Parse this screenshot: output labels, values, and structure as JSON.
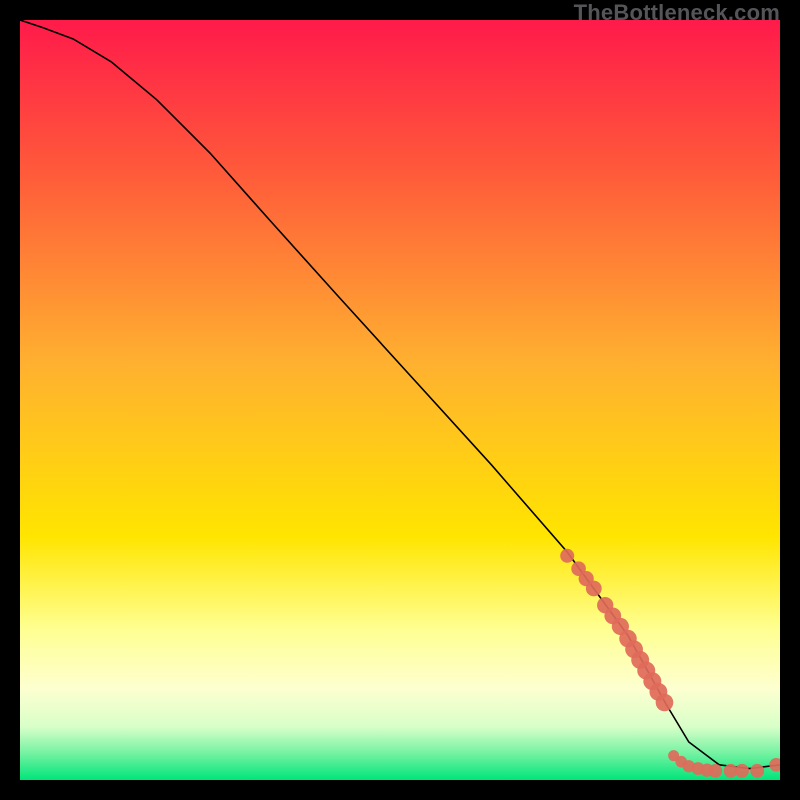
{
  "watermark": "TheBottleneck.com",
  "chart_data": {
    "type": "line",
    "title": "",
    "xlabel": "",
    "ylabel": "",
    "xlim": [
      0,
      100
    ],
    "ylim": [
      0,
      100
    ],
    "grid": false,
    "background_gradient": {
      "top_color": "#ff1a4a",
      "mid_color": "#ffe500",
      "bottom_color": "#00e57a",
      "stops": [
        {
          "offset": 0.0,
          "color": "#ff1a4a"
        },
        {
          "offset": 0.2,
          "color": "#ff5a3a"
        },
        {
          "offset": 0.45,
          "color": "#ffb030"
        },
        {
          "offset": 0.68,
          "color": "#ffe500"
        },
        {
          "offset": 0.8,
          "color": "#ffff90"
        },
        {
          "offset": 0.88,
          "color": "#fdffd0"
        },
        {
          "offset": 0.93,
          "color": "#d8ffc8"
        },
        {
          "offset": 0.965,
          "color": "#74f2a2"
        },
        {
          "offset": 1.0,
          "color": "#00e57a"
        }
      ]
    },
    "series": [
      {
        "name": "curve",
        "type": "line",
        "color": "#000000",
        "width": 1.6,
        "x": [
          0,
          3,
          7,
          12,
          18,
          25,
          33,
          42,
          52,
          62,
          72,
          80,
          85,
          88,
          92,
          96,
          100
        ],
        "y": [
          100,
          99,
          97.5,
          94.5,
          89.5,
          82.5,
          73.5,
          63.5,
          52.5,
          41.5,
          30,
          19,
          10,
          5,
          2,
          1.5,
          2
        ]
      },
      {
        "name": "dots-upper",
        "type": "scatter",
        "color": "#e06a5a",
        "radius_range": [
          5,
          9
        ],
        "x": [
          72,
          73.5,
          74.5,
          75.5,
          77,
          78,
          79,
          80,
          80.8,
          81.6,
          82.4,
          83.2,
          84,
          84.8
        ],
        "y": [
          29.5,
          27.8,
          26.5,
          25.2,
          23,
          21.6,
          20.2,
          18.6,
          17.2,
          15.8,
          14.4,
          13,
          11.6,
          10.2
        ]
      },
      {
        "name": "dots-lower",
        "type": "scatter",
        "color": "#e06a5a",
        "radius_range": [
          4,
          7
        ],
        "x": [
          86,
          87,
          88,
          89.2,
          90.4,
          91.5,
          93.5,
          95,
          97,
          99.5
        ],
        "y": [
          3.2,
          2.4,
          1.8,
          1.5,
          1.3,
          1.2,
          1.2,
          1.2,
          1.2,
          2.0
        ]
      }
    ]
  }
}
